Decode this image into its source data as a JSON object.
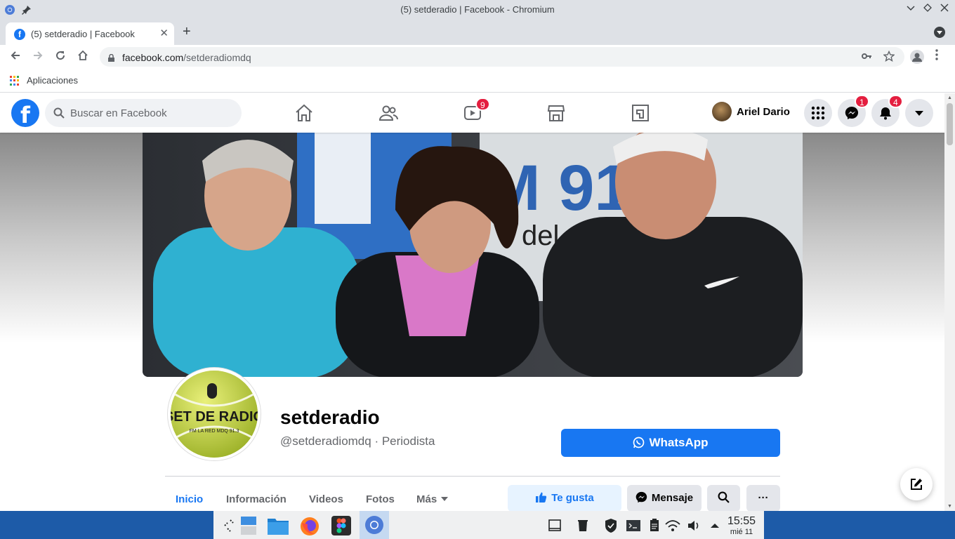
{
  "window": {
    "title": "(5) setderadio | Facebook - Chromium",
    "controls": [
      "chevron-down",
      "diamond",
      "close"
    ]
  },
  "tab": {
    "title": "(5) setderadio | Facebook",
    "close": "✕",
    "new_tab": "+"
  },
  "toolbar": {
    "url_host": "facebook.com",
    "url_path": "/setderadiomdq"
  },
  "bookmarks": {
    "apps_label": "Aplicaciones"
  },
  "fb": {
    "brand_color": "#1877f2",
    "logo": "f",
    "search_placeholder": "Buscar en Facebook",
    "nav": [
      {
        "name": "home",
        "badge": ""
      },
      {
        "name": "friends",
        "badge": ""
      },
      {
        "name": "watch",
        "badge": "9"
      },
      {
        "name": "marketplace",
        "badge": ""
      },
      {
        "name": "gaming",
        "badge": ""
      }
    ],
    "user_name": "Ariel Dario",
    "messenger_badge": "1",
    "notifications_badge": "4"
  },
  "page": {
    "name": "setderadio",
    "handle": "@setderadiomdq · Periodista",
    "logo_text": "SET DE RADIO",
    "logo_subtext": "FM LA RED MDQ 91.3",
    "cover_text_1": "M 91",
    "cover_text_2": "del pl",
    "whatsapp_label": "WhatsApp",
    "tabs": [
      {
        "label": "Inicio",
        "active": true
      },
      {
        "label": "Información",
        "active": false
      },
      {
        "label": "Videos",
        "active": false
      },
      {
        "label": "Fotos",
        "active": false
      },
      {
        "label": "Más",
        "active": false
      }
    ],
    "like_label": "Te gusta",
    "message_label": "Mensaje",
    "more_label": "···"
  },
  "taskbar": {
    "time": "15:55",
    "date": "mié 11"
  }
}
